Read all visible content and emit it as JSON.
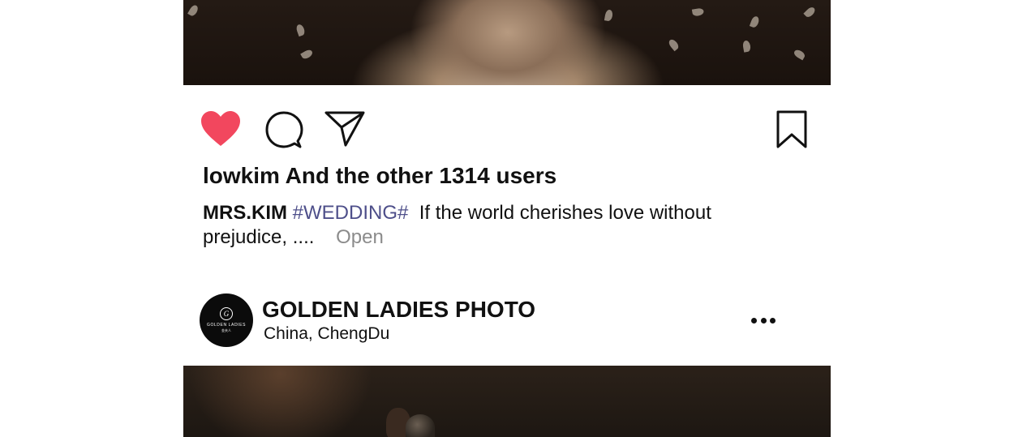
{
  "post_previous": {
    "likes_text": "lowkim And the other 1314 users",
    "caption": {
      "user": "MRS.KIM",
      "hashtag": "#WEDDING#",
      "text": "If the world cherishes love without prejudice, ....",
      "open_label": "Open"
    },
    "icons": {
      "like": "heart-icon",
      "comment": "comment-bubble-icon",
      "share": "paper-plane-icon",
      "save": "bookmark-icon"
    },
    "like_color": "#f2475e"
  },
  "post_next": {
    "account_name": "GOLDEN LADIES PHOTO",
    "location": "China,  ChengDu",
    "avatar": {
      "monogram": "G",
      "brand": "GOLDEN LADIES",
      "sub": "金夫人"
    },
    "more_icon": "more-horizontal-icon"
  },
  "colors": {
    "hashtag": "#4e4f8a",
    "muted": "#8b8b8b",
    "text": "#111111"
  }
}
